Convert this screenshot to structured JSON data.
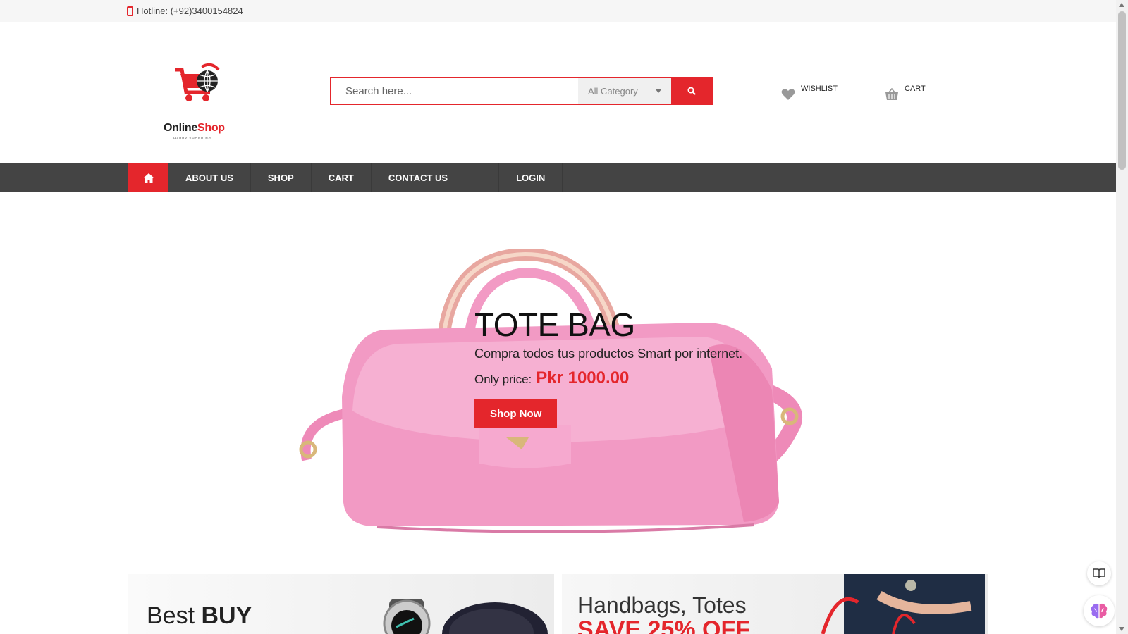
{
  "topbar": {
    "hotline": "Hotline: (+92)3400154824",
    "phone_icon": "mobile-phone-icon"
  },
  "logo": {
    "brand_part1": "Online",
    "brand_part2": "Shop",
    "tagline": "HAPPY SHOPPING",
    "icon": "shopping-cart-globe-icon"
  },
  "search": {
    "placeholder": "Search here...",
    "category": "All Category",
    "button_icon": "search-icon"
  },
  "header_links": {
    "wishlist": "WISHLIST",
    "cart": "CART"
  },
  "nav": {
    "home_icon": "home-icon",
    "items": [
      "ABOUT US",
      "SHOP",
      "CART",
      "CONTACT US"
    ],
    "login": "LOGIN"
  },
  "hero": {
    "title": "TOTE BAG",
    "subtitle": "Compra todos tus productos Smart por internet.",
    "price_label": "Only price:",
    "price": "Pkr 1000.00",
    "button": "Shop Now"
  },
  "banners": {
    "left_text": "Best",
    "left_bold": "BUY",
    "right_line1": "Handbags, Totes",
    "right_line2": "SAVE 25% OFF"
  },
  "colors": {
    "accent": "#e4262c",
    "nav_bg": "#444444",
    "bag_pink": "#f29ac4"
  }
}
